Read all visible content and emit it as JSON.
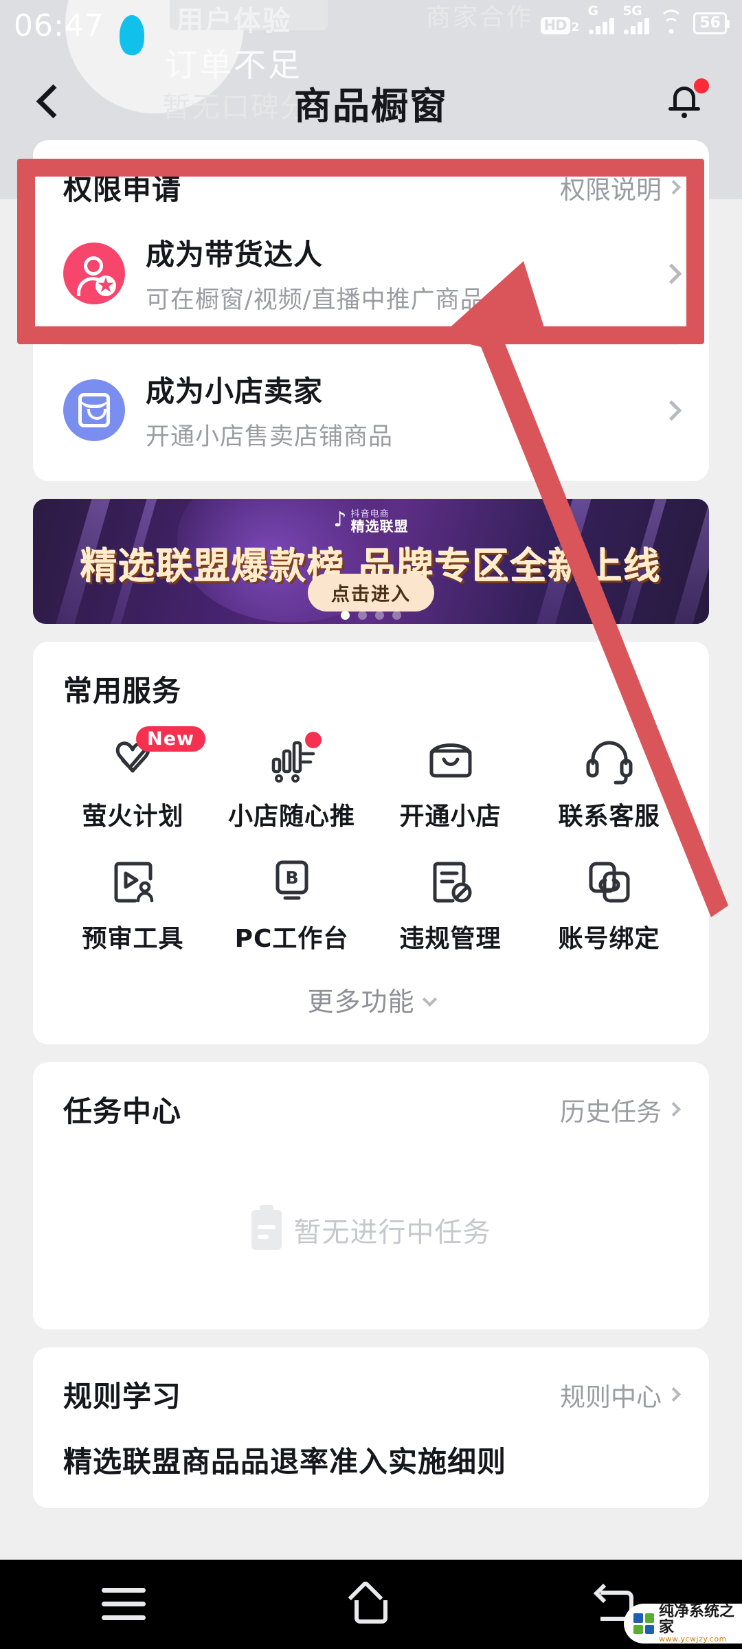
{
  "status_bar": {
    "time": "06:47",
    "hd_label": "HD",
    "hd_sub": "2",
    "net1_label": "G",
    "net2_label": "5G",
    "battery": "56",
    "wifi_icon": "wifi-icon"
  },
  "ghost_background": {
    "chip_text": "用户体验",
    "line1": "订单不足",
    "line2": "暂无口碑分",
    "line2_chevron": "›",
    "merchant_text": "商家合作"
  },
  "header": {
    "title": "商品橱窗",
    "back_icon": "back-chevron-icon",
    "bell_icon": "bell-icon",
    "bell_has_badge": true
  },
  "permission_card": {
    "title": "权限申请",
    "link_label": "权限说明",
    "rows": [
      {
        "name": "成为带货达人",
        "desc": "可在橱窗/视频/直播中推广商品",
        "icon": "person-star-icon",
        "icon_color": "#f7456c"
      },
      {
        "name": "成为小店卖家",
        "desc": "开通小店售卖店铺商品",
        "icon": "shop-bag-icon",
        "icon_color": "#7a8ef0"
      }
    ]
  },
  "banner": {
    "logo_line1": "抖音电商",
    "logo_line2": "精选联盟",
    "note_icon": "music-note-icon",
    "title": "精选联盟爆款榜 品牌专区全新上线",
    "button_label": "点击进入",
    "dots_total": 4,
    "dot_active_index": 0
  },
  "services": {
    "title": "常用服务",
    "items": [
      {
        "label": "萤火计划",
        "icon": "heart-check-icon",
        "badge": "New"
      },
      {
        "label": "小店随心推",
        "icon": "bar-chart-icon",
        "badge_dot": true
      },
      {
        "label": "开通小店",
        "icon": "shop-bag-icon"
      },
      {
        "label": "联系客服",
        "icon": "headset-icon"
      },
      {
        "label": "预审工具",
        "icon": "video-review-icon"
      },
      {
        "label": "PC工作台",
        "icon": "b-tablet-icon"
      },
      {
        "label": "违规管理",
        "icon": "doc-block-icon"
      },
      {
        "label": "账号绑定",
        "icon": "link-copy-icon"
      }
    ],
    "more_label": "更多功能",
    "more_icon": "chevron-down-icon"
  },
  "task_center": {
    "title": "任务中心",
    "link_label": "历史任务",
    "empty_text": "暂无进行中任务",
    "empty_icon": "clipboard-icon"
  },
  "rules": {
    "title": "规则学习",
    "link_label": "规则中心",
    "items": [
      "精选联盟商品品退率准入实施细则"
    ]
  },
  "annotation": {
    "highlight_color": "#d9555a",
    "shapes": [
      "highlight-rectangle",
      "pointer-arrow"
    ]
  },
  "navbar": {
    "menu_icon": "menu-icon",
    "home_icon": "home-icon",
    "back_icon": "back-icon"
  },
  "watermark": {
    "name": "纯净系统之家",
    "url": "www.ycwjzy.com"
  }
}
